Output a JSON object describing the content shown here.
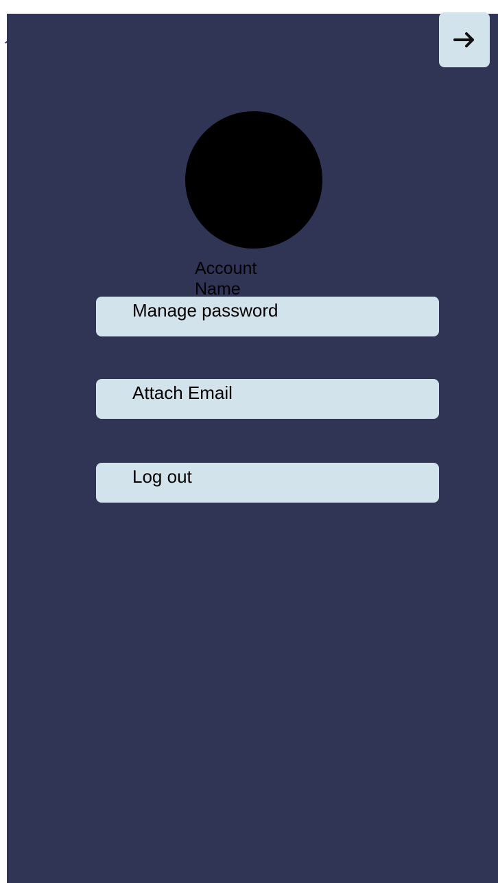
{
  "header": {
    "forward_icon": "arrow-right-icon"
  },
  "profile": {
    "account_name": "Account Name"
  },
  "menu": {
    "items": [
      {
        "label": "Manage password"
      },
      {
        "label": "Attach Email"
      },
      {
        "label": "Log out"
      }
    ]
  },
  "colors": {
    "background": "#303556",
    "button_background": "#d2e3ec",
    "avatar": "#000000",
    "text": "#000000"
  }
}
